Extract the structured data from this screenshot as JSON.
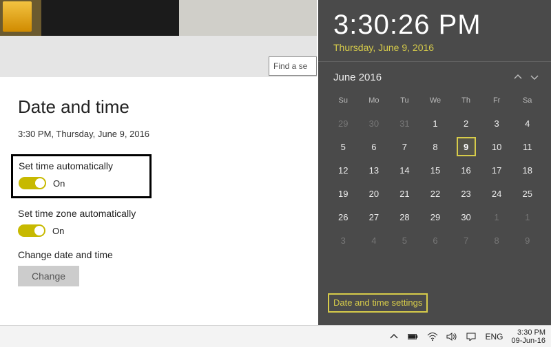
{
  "settings": {
    "search_placeholder": "Find a se",
    "title": "Date and time",
    "current": "3:30 PM, Thursday, June 9, 2016",
    "set_time_auto": {
      "label": "Set time automatically",
      "state": "On"
    },
    "set_tz_auto": {
      "label": "Set time zone automatically",
      "state": "On"
    },
    "change_dt": {
      "label": "Change date and time",
      "button": "Change"
    }
  },
  "flyout": {
    "time": "3:30:26 PM",
    "date": "Thursday, June 9, 2016",
    "month_label": "June 2016",
    "dow": [
      "Su",
      "Mo",
      "Tu",
      "We",
      "Th",
      "Fr",
      "Sa"
    ],
    "weeks": [
      [
        {
          "n": "29",
          "o": true
        },
        {
          "n": "30",
          "o": true
        },
        {
          "n": "31",
          "o": true
        },
        {
          "n": "1"
        },
        {
          "n": "2"
        },
        {
          "n": "3"
        },
        {
          "n": "4"
        }
      ],
      [
        {
          "n": "5"
        },
        {
          "n": "6"
        },
        {
          "n": "7"
        },
        {
          "n": "8"
        },
        {
          "n": "9",
          "t": true
        },
        {
          "n": "10"
        },
        {
          "n": "11"
        }
      ],
      [
        {
          "n": "12"
        },
        {
          "n": "13"
        },
        {
          "n": "14"
        },
        {
          "n": "15"
        },
        {
          "n": "16"
        },
        {
          "n": "17"
        },
        {
          "n": "18"
        }
      ],
      [
        {
          "n": "19"
        },
        {
          "n": "20"
        },
        {
          "n": "21"
        },
        {
          "n": "22"
        },
        {
          "n": "23"
        },
        {
          "n": "24"
        },
        {
          "n": "25"
        }
      ],
      [
        {
          "n": "26"
        },
        {
          "n": "27"
        },
        {
          "n": "28"
        },
        {
          "n": "29"
        },
        {
          "n": "30"
        },
        {
          "n": "1",
          "o": true
        },
        {
          "n": "1",
          "o": true
        }
      ],
      [
        {
          "n": "3",
          "o": true
        },
        {
          "n": "4",
          "o": true
        },
        {
          "n": "5",
          "o": true
        },
        {
          "n": "6",
          "o": true
        },
        {
          "n": "7",
          "o": true
        },
        {
          "n": "8",
          "o": true
        },
        {
          "n": "9",
          "o": true
        }
      ]
    ],
    "settings_link": "Date and time settings"
  },
  "taskbar": {
    "lang": "ENG",
    "clock_time": "3:30 PM",
    "clock_date": "09-Jun-16"
  }
}
